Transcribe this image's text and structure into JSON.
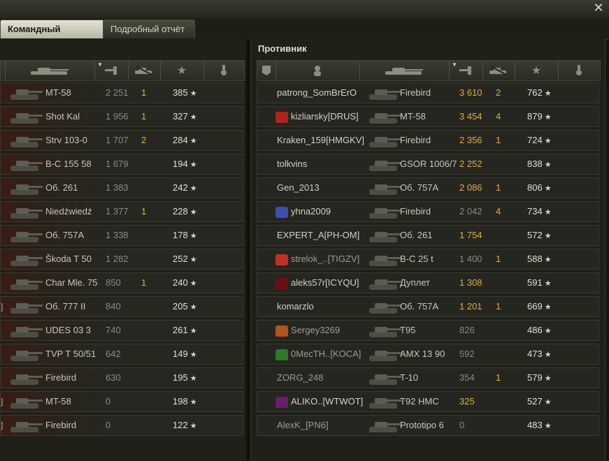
{
  "window": {
    "close_glyph": "✕"
  },
  "tabs": [
    {
      "label": "Командный результат",
      "active": true
    },
    {
      "label": "Подробный отчёт",
      "active": false
    }
  ],
  "left_panel": {
    "rows": [
      {
        "tank": "MT-58",
        "damage": "2 251",
        "kills": "1",
        "xp": "385"
      },
      {
        "tank": "Shot Kal",
        "damage": "1 956",
        "kills": "1",
        "xp": "327"
      },
      {
        "tank": "Strv 103-0",
        "damage": "1 707",
        "kills": "2",
        "xp": "284"
      },
      {
        "tank": "B-C 155 58",
        "damage": "1 679",
        "kills": "",
        "xp": "194"
      },
      {
        "tank": "Об. 261",
        "damage": "1 383",
        "kills": "",
        "xp": "242"
      },
      {
        "tank": "Niedźwiedź",
        "damage": "1 377",
        "kills": "1",
        "xp": "228"
      },
      {
        "tank": "Об. 757А",
        "damage": "1 338",
        "kills": "",
        "xp": "178"
      },
      {
        "tank": "Škoda T 50",
        "damage": "1 282",
        "kills": "",
        "xp": "252"
      },
      {
        "tank": "Char Mle. 75",
        "damage": "850",
        "kills": "1",
        "xp": "240"
      },
      {
        "tank": "Об. 777 II",
        "damage": "840",
        "kills": "",
        "xp": "205",
        "edge": "]"
      },
      {
        "tank": "UDES 03 3",
        "damage": "740",
        "kills": "",
        "xp": "261"
      },
      {
        "tank": "TVP T 50/51",
        "damage": "642",
        "kills": "",
        "xp": "149"
      },
      {
        "tank": "Firebird",
        "damage": "630",
        "kills": "",
        "xp": "195"
      },
      {
        "tank": "MT-58",
        "damage": "0",
        "kills": "",
        "xp": "198",
        "edge": "]"
      },
      {
        "tank": "Firebird",
        "damage": "0",
        "kills": "",
        "xp": "122",
        "edge": "]"
      }
    ]
  },
  "right_panel": {
    "title": "Противник",
    "rows": [
      {
        "player": "patrong_SomBrErO",
        "badge": "",
        "tank": "Firebird",
        "damage": "3 610",
        "dmg_hi": true,
        "kills": "2",
        "xp": "762"
      },
      {
        "player": "kizliarsky[DRUS]",
        "badge": "#b2231c",
        "tank": "MT-58",
        "damage": "3 454",
        "dmg_hi": true,
        "kills": "4",
        "xp": "879"
      },
      {
        "player": "Kraken_159[HMGKV]",
        "badge": "",
        "tank": "Firebird",
        "damage": "2 356",
        "dmg_hi": true,
        "kills": "1",
        "xp": "724"
      },
      {
        "player": "tolkvins",
        "badge": "",
        "tank": "GSOR 1006/7",
        "damage": "2 252",
        "dmg_hi": true,
        "kills": "",
        "xp": "838"
      },
      {
        "player": "Gen_2013",
        "badge": "",
        "tank": "Об. 757А",
        "damage": "2 086",
        "dmg_hi": true,
        "kills": "1",
        "xp": "806"
      },
      {
        "player": "yhna2009",
        "badge": "#3a4fb0",
        "tank": "Firebird",
        "damage": "2 042",
        "dmg_hi": false,
        "kills": "4",
        "xp": "734"
      },
      {
        "player": "EXPERT_A[PH-OM]",
        "badge": "",
        "tank": "Об. 261",
        "damage": "1 754",
        "dmg_hi": true,
        "kills": "",
        "xp": "572"
      },
      {
        "player": "strelok_..[TIGZV]",
        "badge": "#c0321e",
        "tank": "B-C 25 t",
        "damage": "1 400",
        "dmg_hi": false,
        "kills": "1",
        "xp": "588",
        "dim": true
      },
      {
        "player": "aleks57r[ICYQU]",
        "badge": "#6b1010",
        "tank": "Дуплет",
        "damage": "1 308",
        "dmg_hi": true,
        "kills": "",
        "xp": "591"
      },
      {
        "player": "komarzlo",
        "badge": "",
        "tank": "Об. 757А",
        "damage": "1 201",
        "dmg_hi": true,
        "kills": "1",
        "xp": "669"
      },
      {
        "player": "Sergey3269",
        "badge": "#b2541c",
        "tank": "T95",
        "damage": "826",
        "dmg_hi": false,
        "kills": "",
        "xp": "486",
        "dim": true
      },
      {
        "player": "0MecTH..[KOCA]",
        "badge": "#2f7a2a",
        "tank": "AMX 13 90",
        "damage": "592",
        "dmg_hi": false,
        "kills": "",
        "xp": "473",
        "dim": true
      },
      {
        "player": "ZORG_248",
        "badge": "",
        "tank": "T-10",
        "damage": "354",
        "dmg_hi": false,
        "kills": "1",
        "xp": "579",
        "dim": true
      },
      {
        "player": "ALIKO..[WTWOT]",
        "badge": "#6a1c6e",
        "tank": "T92 HMC",
        "damage": "325",
        "dmg_hi": true,
        "kills": "",
        "xp": "527"
      },
      {
        "player": "AlexK_[PN6]",
        "badge": "",
        "tank": "Prototipo 6",
        "damage": "0",
        "dmg_hi": false,
        "kills": "",
        "xp": "483",
        "dim": true
      }
    ]
  },
  "star_glyph": "★",
  "sort_glyph": "▼"
}
